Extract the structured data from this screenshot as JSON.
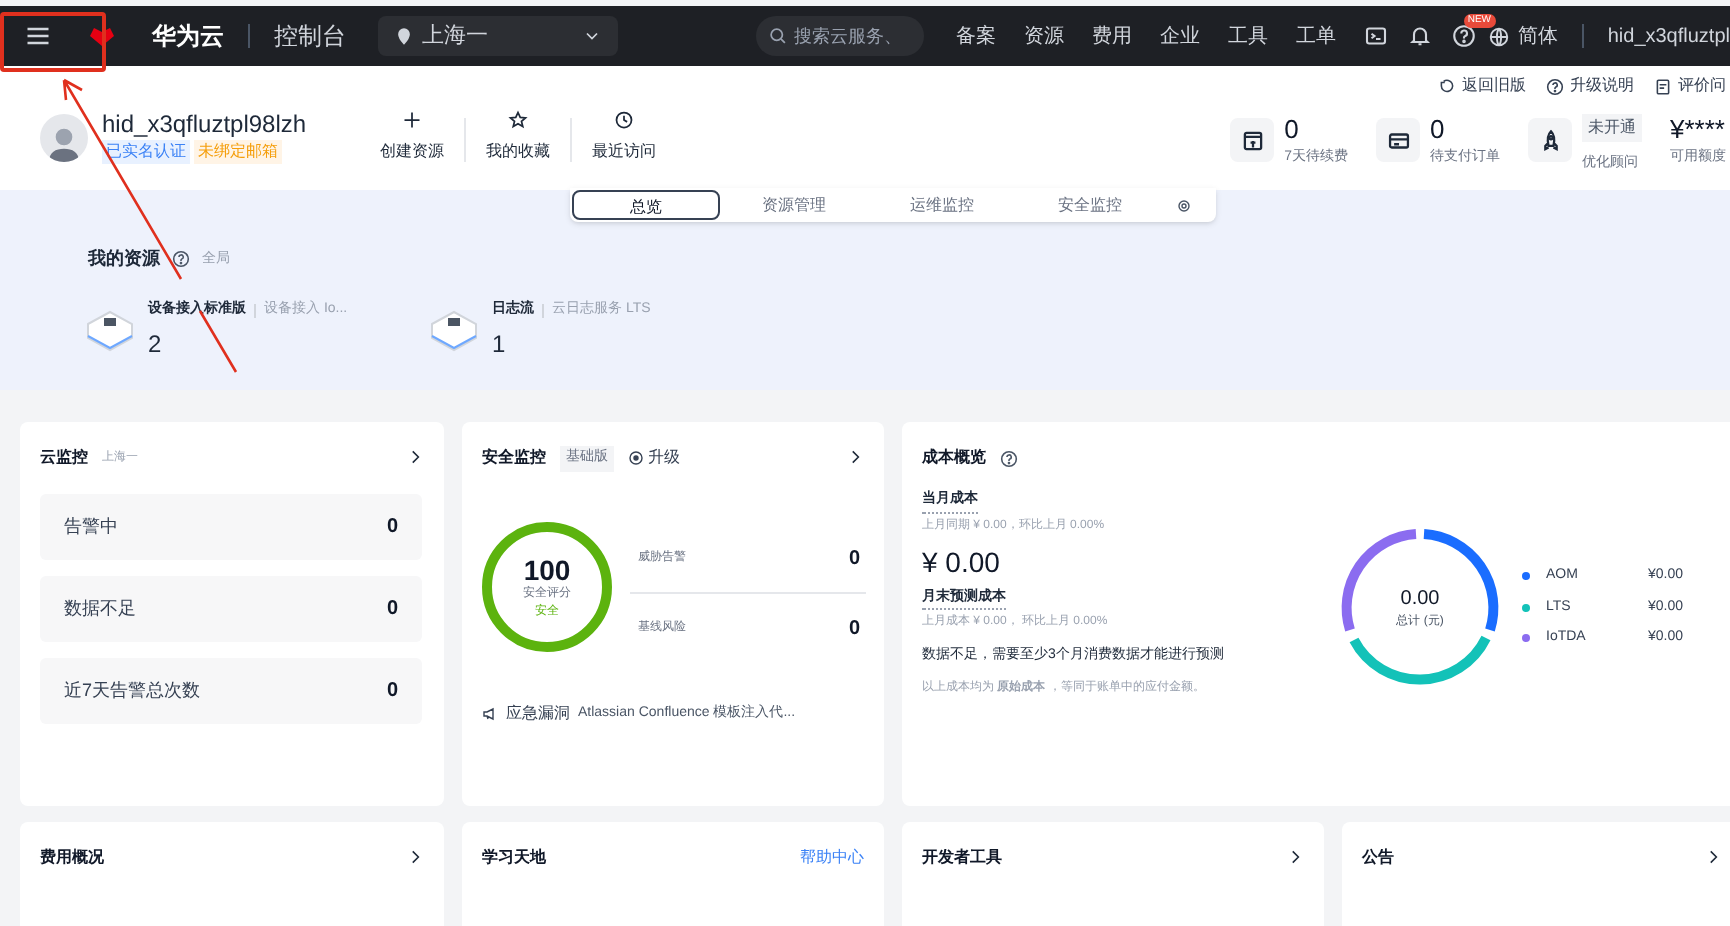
{
  "navbar": {
    "brand": "华为云",
    "console": "控制台",
    "region": "上海一",
    "search_placeholder": "搜索云服务、",
    "links": [
      "备案",
      "资源",
      "费用",
      "企业",
      "工具",
      "工单"
    ],
    "new_badge": "NEW",
    "language": "简体",
    "user": "hid_x3qfluztpl"
  },
  "top_links": [
    "返回旧版",
    "升级说明",
    "评价问"
  ],
  "profile": {
    "name": "hid_x3qfluztpl98lzh",
    "tags": [
      {
        "text": "已实名认证",
        "kind": "verified"
      },
      {
        "text": "未绑定邮箱",
        "kind": "warning"
      }
    ]
  },
  "quick_actions": [
    {
      "label": "创建资源",
      "kind": "plus"
    },
    {
      "label": "我的收藏",
      "kind": "star"
    },
    {
      "label": "最近访问",
      "kind": "clock"
    }
  ],
  "stats": [
    {
      "value": "0",
      "label": "7天待续费",
      "kind": "number"
    },
    {
      "value": "0",
      "label": "待支付订单",
      "kind": "number"
    },
    {
      "value": "未开通",
      "label": "优化顾问",
      "kind": "badge"
    },
    {
      "value": "¥****",
      "label": "可用额度",
      "kind": "number"
    }
  ],
  "tabs": [
    {
      "label": "总览",
      "selected": true
    },
    {
      "label": "资源管理",
      "selected": false
    },
    {
      "label": "运维监控",
      "selected": false
    },
    {
      "label": "安全监控",
      "selected": false
    }
  ],
  "resources": {
    "title": "我的资源",
    "scope": "全局",
    "items": [
      {
        "name": "设备接入标准版",
        "service": "设备接入 Io...",
        "count": "2"
      },
      {
        "name": "日志流",
        "service": "云日志服务 LTS",
        "count": "1"
      }
    ]
  },
  "cloud_monitor": {
    "title": "云监控",
    "region": "上海一",
    "rows": [
      {
        "label": "告警中",
        "value": "0"
      },
      {
        "label": "数据不足",
        "value": "0"
      },
      {
        "label": "近7天告警总次数",
        "value": "0"
      }
    ]
  },
  "security": {
    "title": "安全监控",
    "edition": "基础版",
    "upgrade": "升级",
    "score": "100",
    "score_label": "安全评分",
    "status": "安全",
    "rows": [
      {
        "label": "威胁告警",
        "value": "0"
      },
      {
        "label": "基线风险",
        "value": "0"
      }
    ],
    "notice_tag": "应急漏洞",
    "notice": "Atlassian Confluence 模板注入代..."
  },
  "cost": {
    "title": "成本概览",
    "current_label": "当月成本",
    "current_compare": "上月同期 ¥ 0.00，环比上月 0.00%",
    "current_value": "¥ 0.00",
    "forecast_label": "月末预测成本",
    "forecast_compare": "上月成本 ¥ 0.00， 环比上月 0.00%",
    "warning": "数据不足，需要至少3个月消费数据才能进行预测",
    "note": "以上成本均为 **原始成本** ，等同于账单中的应付金额。",
    "total": "0.00",
    "total_label": "总计 (元)",
    "legend": [
      {
        "name": "AOM",
        "value": "¥0.00",
        "color": "#1a6dff"
      },
      {
        "name": "LTS",
        "value": "¥0.00",
        "color": "#13c2b8"
      },
      {
        "name": "IoTDA",
        "value": "¥0.00",
        "color": "#8b6cf0"
      }
    ]
  },
  "bottom_cards": [
    {
      "title": "费用概况"
    },
    {
      "title": "学习天地",
      "link": "帮助中心"
    },
    {
      "title": "开发者工具"
    },
    {
      "title": "公告"
    }
  ]
}
